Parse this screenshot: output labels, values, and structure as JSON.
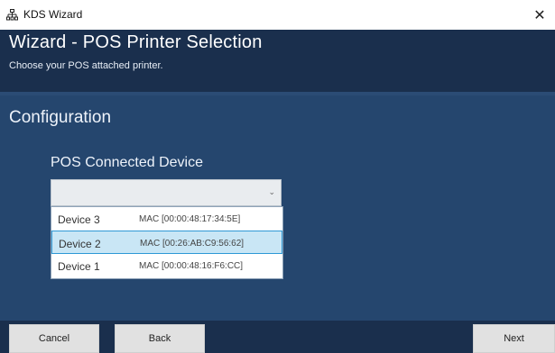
{
  "window": {
    "title": "KDS Wizard",
    "close_glyph": "✕",
    "icon": "network-icon"
  },
  "header": {
    "title": "Wizard - POS Printer Selection",
    "subtitle": "Choose your POS attached printer."
  },
  "main": {
    "section_title": "Configuration",
    "field_label": "POS Connected Device",
    "combo": {
      "value": "",
      "chevron": "⌄"
    },
    "devices": [
      {
        "name": "Device 3",
        "mac": "MAC [00:00:48:17:34:5E]",
        "selected": false
      },
      {
        "name": "Device 2",
        "mac": "MAC [00:26:AB:C9:56:62]",
        "selected": true
      },
      {
        "name": "Device 1",
        "mac": "MAC [00:00:48:16:F6:CC]",
        "selected": false
      }
    ]
  },
  "footer": {
    "cancel_label": "Cancel",
    "back_label": "Back",
    "next_label": "Next"
  },
  "colors": {
    "header_bg": "#1a2f4d",
    "main_bg": "#25466e",
    "selection_bg": "#c9e6f5",
    "selection_border": "#2e98d6"
  }
}
